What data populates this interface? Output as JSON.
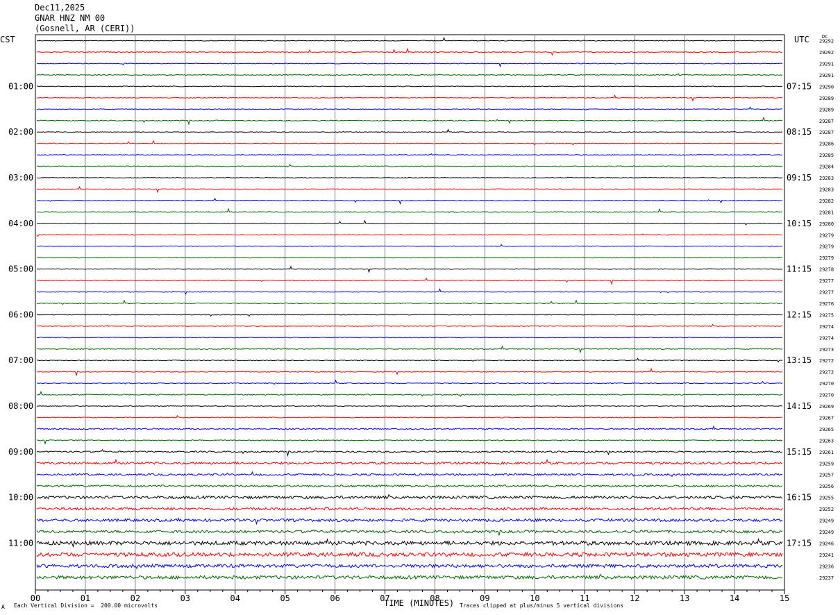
{
  "header": {
    "date": "Dec11,2025",
    "channel": "GNAR HNZ NM 00",
    "location": "(Gosnell, AR (CERI))"
  },
  "left_tz": "CST",
  "right_tz": "UTC",
  "dc_header": "DC",
  "footer": {
    "scale_note": "Each Vertical Division =  200.00 microvolts",
    "clip_note": "Traces clipped at plus/minus 5 vertical divisions",
    "corner_mark": "A"
  },
  "colors": {
    "cycle": [
      "#000000",
      "#ff0000",
      "#0000ff",
      "#006400"
    ],
    "grid": "#8080a0"
  },
  "chart_data": {
    "type": "line",
    "xlabel": "TIME (MINUTES)",
    "xlim": [
      0,
      15
    ],
    "x_ticks": [
      "00",
      "01",
      "02",
      "03",
      "04",
      "05",
      "06",
      "07",
      "08",
      "09",
      "10",
      "11",
      "12",
      "13",
      "14",
      "15"
    ],
    "hour_labels_left": [
      "01:00",
      "02:00",
      "03:00",
      "04:00",
      "05:00",
      "06:00",
      "07:00",
      "08:00",
      "09:00",
      "10:00",
      "11:00"
    ],
    "hour_labels_right": [
      "07:15",
      "08:15",
      "09:15",
      "10:15",
      "11:15",
      "12:15",
      "13:15",
      "14:15",
      "15:15",
      "16:15",
      "17:15"
    ],
    "dc_offsets": [
      "29292",
      "29292",
      "29291",
      "29291",
      "29290",
      "29289",
      "29289",
      "29287",
      "29287",
      "29286",
      "29285",
      "29284",
      "29283",
      "29283",
      "29282",
      "29281",
      "29280",
      "29279",
      "29279",
      "29279",
      "29278",
      "29277",
      "29277",
      "29276",
      "29275",
      "29274",
      "29274",
      "29273",
      "29272",
      "29272",
      "29270",
      "29270",
      "29269",
      "29267",
      "29265",
      "29263",
      "29261",
      "29259",
      "29257",
      "29256",
      "29255",
      "29252",
      "29249",
      "29249",
      "29246",
      "29241",
      "29236",
      "29237"
    ],
    "noise_level": [
      0.5,
      0.6,
      0.5,
      0.6,
      0.5,
      0.5,
      0.5,
      0.6,
      0.5,
      0.5,
      0.5,
      0.6,
      0.5,
      0.5,
      0.5,
      0.6,
      0.5,
      0.5,
      0.5,
      0.6,
      0.5,
      0.6,
      0.5,
      0.6,
      0.5,
      0.5,
      0.5,
      0.6,
      0.5,
      0.6,
      0.6,
      0.7,
      0.5,
      0.6,
      0.9,
      0.6,
      1.0,
      1.6,
      1.3,
      1.4,
      2.0,
      1.8,
      2.0,
      1.9,
      2.8,
      2.8,
      2.4,
      2.4
    ]
  }
}
